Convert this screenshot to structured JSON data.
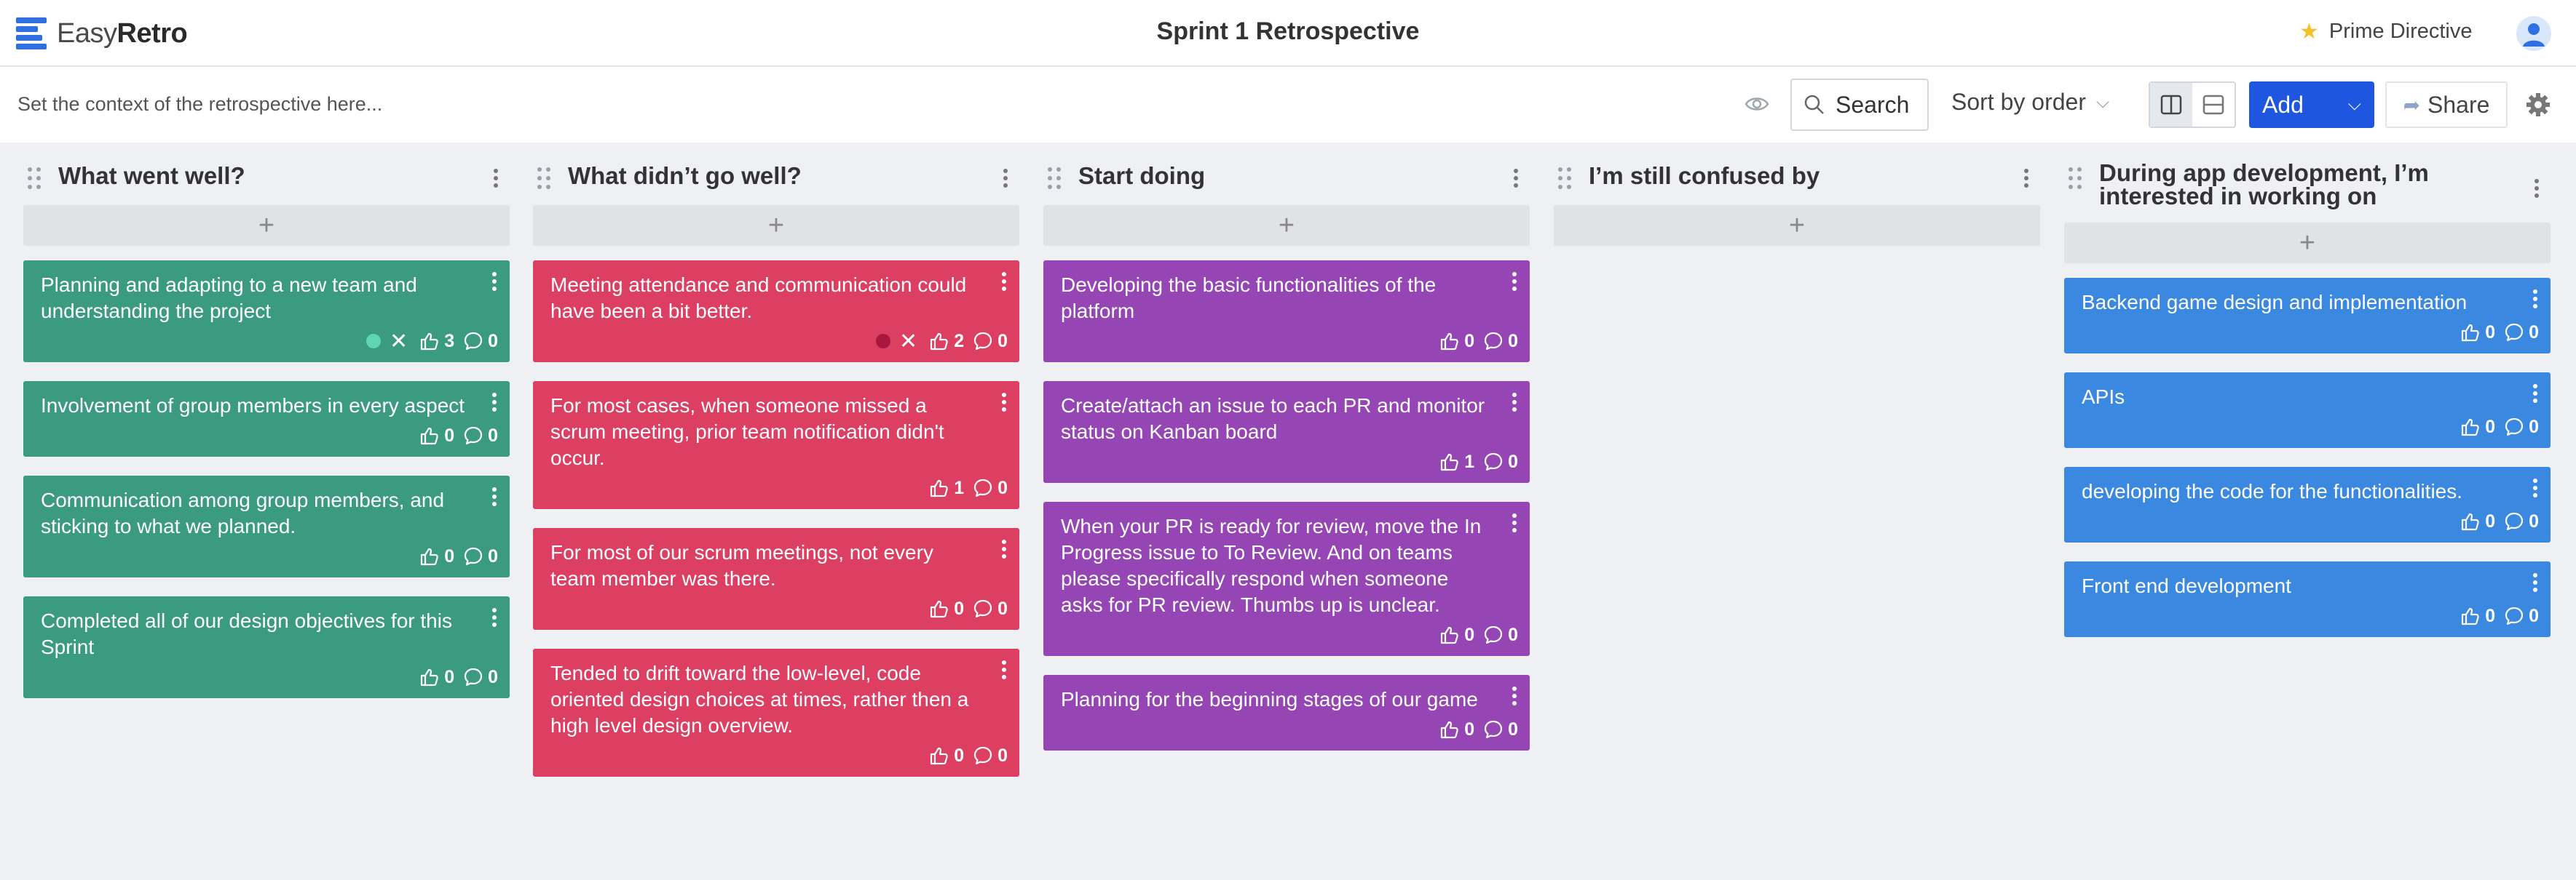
{
  "app": {
    "logo_light": "Easy",
    "logo_bold": "Retro"
  },
  "header": {
    "title": "Sprint 1 Retrospective",
    "prime_directive": "Prime Directive"
  },
  "toolbar": {
    "context_placeholder": "Set the context of the retrospective here...",
    "search_label": "Search",
    "sort_label": "Sort by order",
    "add_label": "Add",
    "share_label": "Share"
  },
  "colors": {
    "green": "#3b9b80",
    "red": "#dc3f62",
    "purple": "#9645b5",
    "blue": "#3a88e0",
    "accent": "#1f56e0"
  },
  "columns": [
    {
      "title": "What went well?",
      "add_label": "+",
      "cards": [
        {
          "text": "Planning and adapting to a new team and understanding the project",
          "likes": "3",
          "comments": "0",
          "voted": true
        },
        {
          "text": "Involvement of group members in every aspect",
          "likes": "0",
          "comments": "0"
        },
        {
          "text": "Communication among group members, and sticking to what we planned.",
          "likes": "0",
          "comments": "0"
        },
        {
          "text": "Completed all of our design objectives for this Sprint",
          "likes": "0",
          "comments": "0"
        }
      ]
    },
    {
      "title": "What didn’t go well?",
      "add_label": "+",
      "cards": [
        {
          "text": "Meeting attendance and communication could have been a bit better.",
          "likes": "2",
          "comments": "0",
          "voted": true
        },
        {
          "text": "For most cases, when someone missed a scrum meeting, prior team notification didn't occur.",
          "likes": "1",
          "comments": "0"
        },
        {
          "text": "For most of our scrum meetings, not every team member was there.",
          "likes": "0",
          "comments": "0"
        },
        {
          "text": "Tended to drift toward the low-level, code oriented design choices at times, rather then a high level design overview.",
          "likes": "0",
          "comments": "0"
        }
      ]
    },
    {
      "title": "Start doing",
      "add_label": "+",
      "cards": [
        {
          "text": "Developing the basic functionalities of the platform",
          "likes": "0",
          "comments": "0"
        },
        {
          "text": "Create/attach an issue to each PR and monitor status on Kanban board",
          "likes": "1",
          "comments": "0"
        },
        {
          "text": "When your PR is ready for review, move the In Progress issue to To Review. And on teams please specifically respond when someone asks for PR review. Thumbs up is unclear.",
          "likes": "0",
          "comments": "0"
        },
        {
          "text": "Planning for the beginning stages of our game",
          "likes": "0",
          "comments": "0"
        }
      ]
    },
    {
      "title": "I’m still confused by",
      "add_label": "+",
      "cards": []
    },
    {
      "title": "During app development, I’m interested in working on",
      "add_label": "+",
      "cards": [
        {
          "text": "Backend game design and implementation",
          "likes": "0",
          "comments": "0"
        },
        {
          "text": "APIs",
          "likes": "0",
          "comments": "0"
        },
        {
          "text": "developing the code for the functionalities.",
          "likes": "0",
          "comments": "0"
        },
        {
          "text": "Front end development",
          "likes": "0",
          "comments": "0"
        }
      ]
    }
  ]
}
